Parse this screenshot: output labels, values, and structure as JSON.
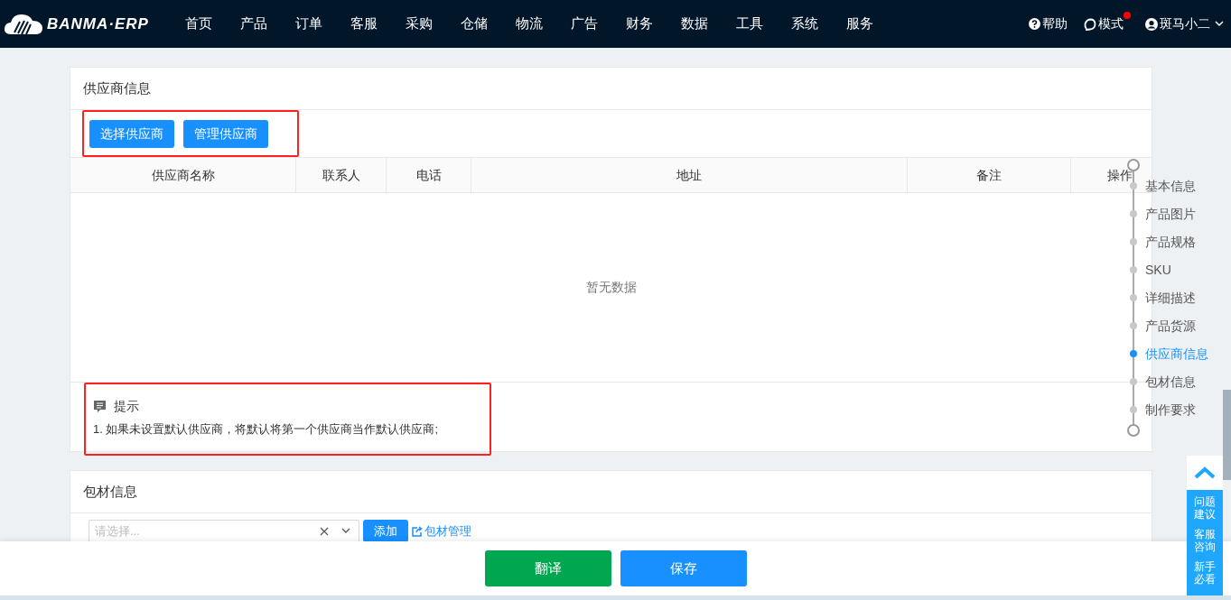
{
  "navbar": {
    "logo": "BANMA·ERP",
    "menu": [
      "首页",
      "产品",
      "订单",
      "客服",
      "采购",
      "仓储",
      "物流",
      "广告",
      "财务",
      "数据",
      "工具",
      "系统",
      "服务"
    ],
    "help": "帮助",
    "mode": {
      "label": "模式",
      "notification": true
    },
    "user": "斑马小二"
  },
  "supplier_section": {
    "title": "供应商信息",
    "buttons": [
      "选择供应商",
      "管理供应商"
    ],
    "table": {
      "columns": [
        "供应商名称",
        "联系人",
        "电话",
        "地址",
        "备注",
        "操作"
      ],
      "empty_text": "暂无数据"
    },
    "tip": {
      "title": "提示",
      "lines": [
        "1. 如果未设置默认供应商，将默认将第一个供应商当作默认供应商;"
      ]
    }
  },
  "packaging_section": {
    "title": "包材信息",
    "select": {
      "placeholder": "请选择..."
    },
    "add_button": "添加",
    "manage_link": "包材管理"
  },
  "anchor_nav": [
    {
      "label": "基本信息",
      "selected": false
    },
    {
      "label": "产品图片",
      "selected": false
    },
    {
      "label": "产品规格",
      "selected": false
    },
    {
      "label": "SKU",
      "selected": false
    },
    {
      "label": "详细描述",
      "selected": false
    },
    {
      "label": "产品货源",
      "selected": false
    },
    {
      "label": "供应商信息",
      "selected": true
    },
    {
      "label": "包材信息",
      "selected": false
    },
    {
      "label": "制作要求",
      "selected": false
    }
  ],
  "footer": {
    "buttons": [
      {
        "label": "翻译",
        "kind": "secondary"
      },
      {
        "label": "保存",
        "kind": "primary"
      }
    ]
  },
  "float_panel": {
    "items": [
      "问题建议",
      "客服咨询",
      "新手必看"
    ]
  }
}
